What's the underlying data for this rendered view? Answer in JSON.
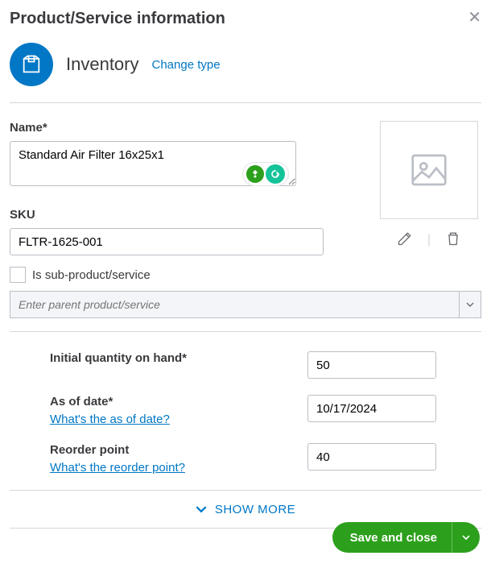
{
  "header": {
    "title": "Product/Service information"
  },
  "type": {
    "label": "Inventory",
    "change_link": "Change type"
  },
  "name": {
    "label": "Name*",
    "value": "Standard Air Filter 16x25x1"
  },
  "sku": {
    "label": "SKU",
    "value": "FLTR-1625-001"
  },
  "sub_product": {
    "label": "Is sub-product/service",
    "parent_placeholder": "Enter parent product/service"
  },
  "inventory": {
    "initial_qty": {
      "label": "Initial quantity on hand*",
      "value": "50"
    },
    "as_of_date": {
      "label": "As of date*",
      "help": "What's the as of date?",
      "value": "10/17/2024"
    },
    "reorder_point": {
      "label": "Reorder point",
      "help": "What's the reorder point?",
      "value": "40"
    }
  },
  "show_more": "SHOW MORE",
  "footer": {
    "save": "Save and close"
  }
}
